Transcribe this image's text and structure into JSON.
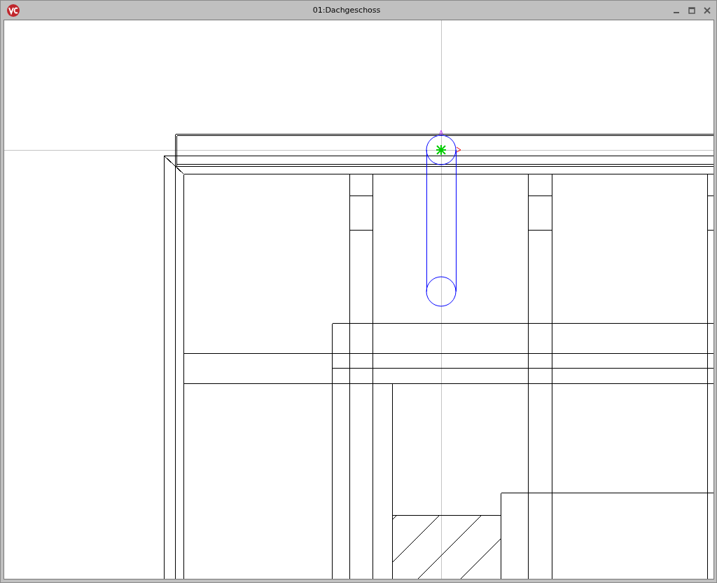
{
  "window": {
    "title": "01:Dachgeschoss"
  }
}
